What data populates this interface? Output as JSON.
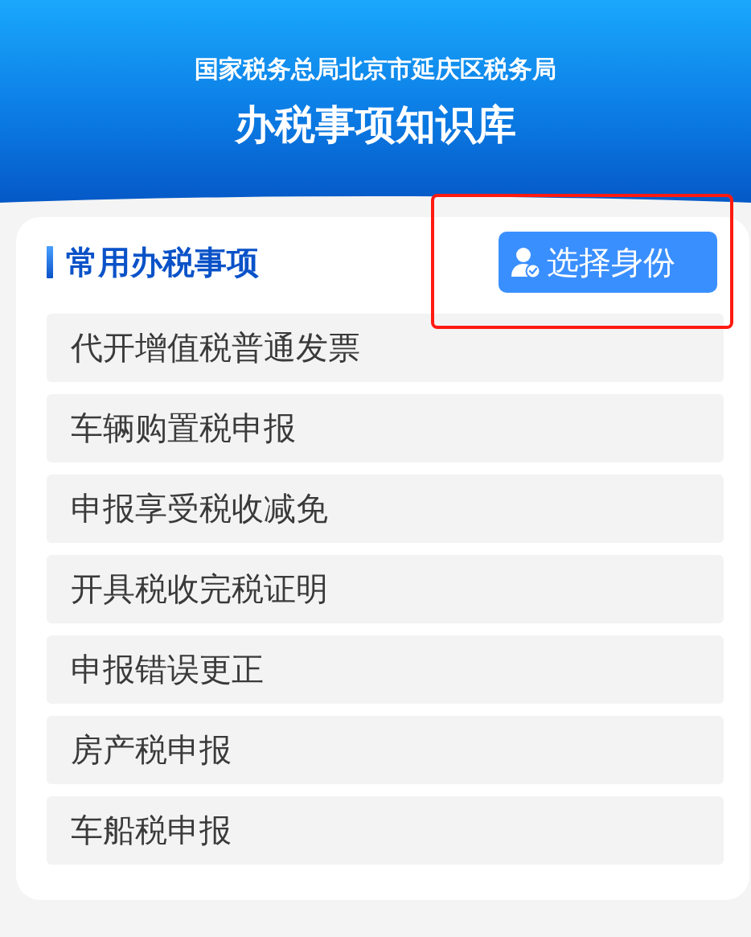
{
  "header": {
    "subtitle": "国家税务总局北京市延庆区税务局",
    "title": "办税事项知识库"
  },
  "section": {
    "title": "常用办税事项",
    "identity_button": {
      "label": "选择身份",
      "highlighted": true
    }
  },
  "items": [
    {
      "label": "代开增值税普通发票"
    },
    {
      "label": "车辆购置税申报"
    },
    {
      "label": "申报享受税收减免"
    },
    {
      "label": "开具税收完税证明"
    },
    {
      "label": "申报错误更正"
    },
    {
      "label": "房产税申报"
    },
    {
      "label": "车船税申报"
    }
  ]
}
